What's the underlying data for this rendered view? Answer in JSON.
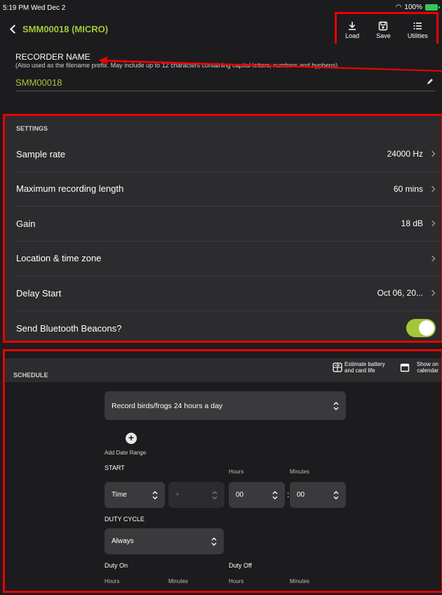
{
  "status_bar": {
    "time": "5:19 PM  Wed Dec 2",
    "battery": "100%"
  },
  "nav": {
    "back_title": "SMM00018 (MICRO)",
    "toolbar": [
      {
        "label": "Load",
        "icon": "download-icon"
      },
      {
        "label": "Save",
        "icon": "save-icon"
      },
      {
        "label": "Utilities",
        "icon": "list-icon"
      }
    ]
  },
  "recorder_name": {
    "title": "RECORDER NAME",
    "hint": "(Also used as the filename prefix. May include up to 12 characters containing capital letters, numbers and hyphens)",
    "value": "SMM00018"
  },
  "settings": {
    "header": "SETTINGS",
    "rows": [
      {
        "label": "Sample rate",
        "value": "24000 Hz"
      },
      {
        "label": "Maximum recording length",
        "value": "60 mins"
      },
      {
        "label": "Gain",
        "value": "18 dB"
      },
      {
        "label": "Location & time zone",
        "value": ""
      },
      {
        "label": "Delay Start",
        "value": "Oct 06, 20..."
      },
      {
        "label": "Send Bluetooth Beacons?",
        "toggle": true
      }
    ]
  },
  "schedule": {
    "header": "SCHEDULE",
    "estimate_label": "Estimate battery and card life",
    "calendar_label": "Show on calendar",
    "preset": "Record birds/frogs 24 hours a day",
    "add_date_range": "Add Date Range",
    "start_label": "START",
    "start_type": "Time",
    "offset_sign": "+",
    "hours_label": "Hours",
    "minutes_label": "Minutes",
    "start_hours": "00",
    "start_minutes": "00",
    "colon": ":",
    "duty_cycle_label": "DUTY CYCLE",
    "duty_cycle_value": "Always",
    "duty_on_label": "Duty On",
    "duty_off_label": "Duty Off"
  },
  "colors": {
    "accent": "#a4c639",
    "highlight": "#ee0000",
    "background": "#1c1c1e",
    "panel": "#2c2c2e"
  }
}
